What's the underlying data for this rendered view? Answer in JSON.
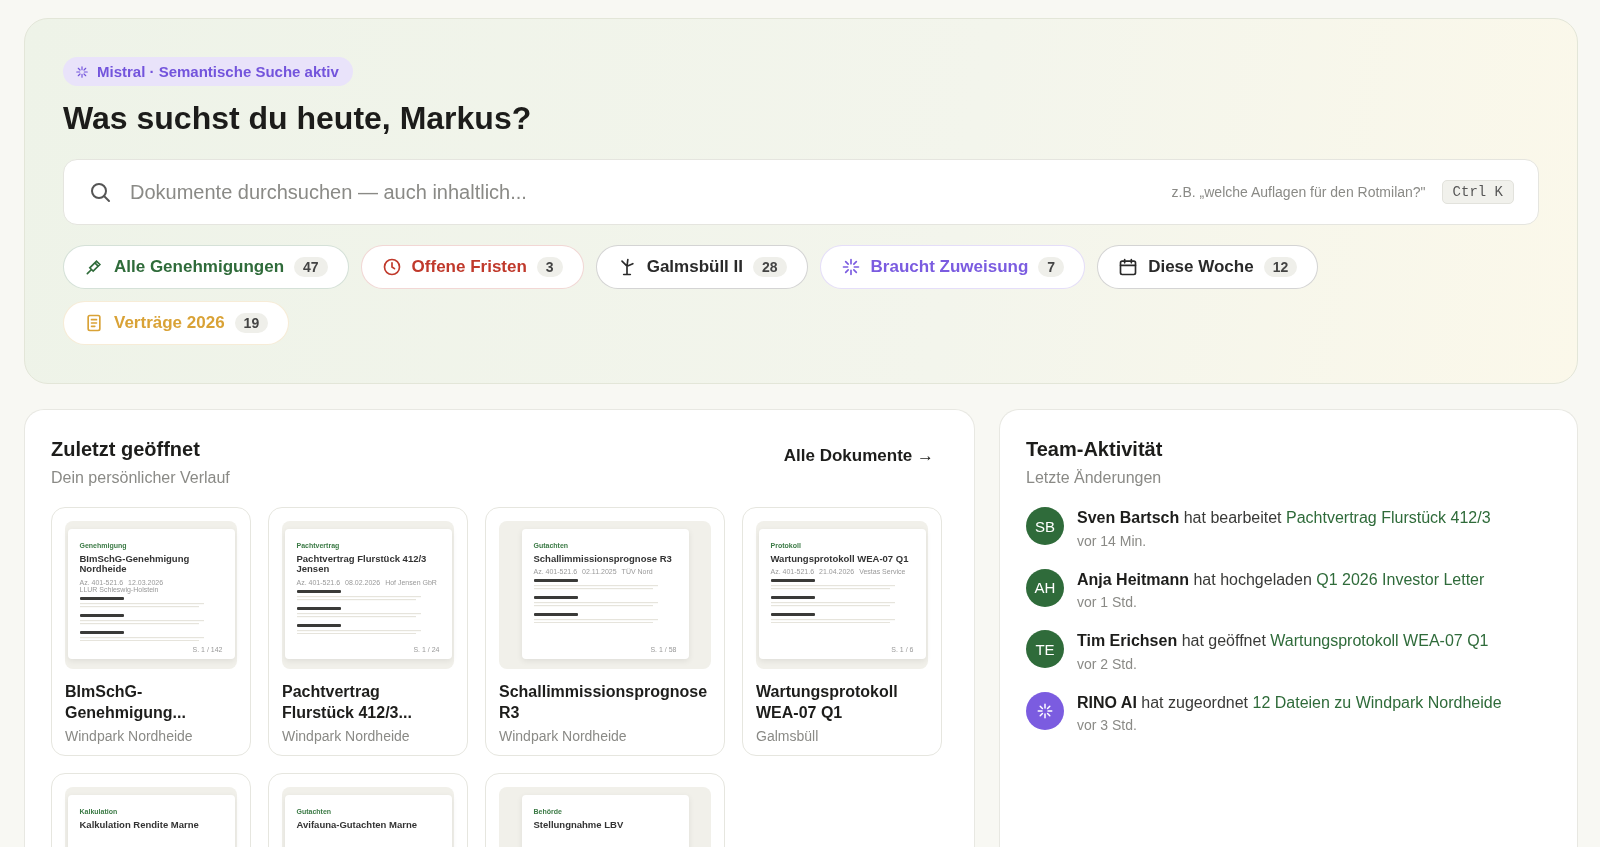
{
  "hero": {
    "badge": "Mistral · Semantische Suche aktiv",
    "heading": "Was suchst du heute, Markus?",
    "search": {
      "placeholder": "Dokumente durchsuchen — auch inhaltlich...",
      "hint": "z.B. „welche Auflagen für den Rotmilan?\"",
      "shortcut": "Ctrl K"
    },
    "chips": [
      {
        "kind": "permit",
        "label": "Alle Genehmigungen",
        "count": "47",
        "color": "#2f6b3a"
      },
      {
        "kind": "deadline",
        "label": "Offene Fristen",
        "count": "3",
        "color": "#c0392b"
      },
      {
        "kind": "site",
        "label": "Galmsbüll II",
        "count": "28",
        "color": "#2a2a2a"
      },
      {
        "kind": "ai",
        "label": "Braucht Zuweisung",
        "count": "7",
        "color": "#7b5ce0"
      },
      {
        "kind": "week",
        "label": "Diese Woche",
        "count": "12",
        "color": "#2a2a2a"
      },
      {
        "kind": "contracts",
        "label": "Verträge 2026",
        "count": "19",
        "color": "#d9a236"
      }
    ]
  },
  "recent": {
    "title": "Zuletzt geöffnet",
    "subtitle": "Dein persönlicher Verlauf",
    "link": "Alle Dokumente →",
    "documents": [
      {
        "category": "Genehmigung",
        "preview_title": "BImSchG-Genehmigung Nordheide",
        "meta": [
          "Az. 401-521.6",
          "12.03.2026",
          "LLUR Schleswig-Holstein"
        ],
        "pages": "S. 1 / 142",
        "title": "BImSchG-Genehmigung...",
        "project": "Windpark Nordheide"
      },
      {
        "category": "Pachtvertrag",
        "preview_title": "Pachtvertrag Flurstück 412/3 Jensen",
        "meta": [
          "Az. 401-521.6",
          "08.02.2026",
          "Hof Jensen GbR"
        ],
        "pages": "S. 1 / 24",
        "title": "Pachtvertrag Flurstück 412/3...",
        "project": "Windpark Nordheide"
      },
      {
        "category": "Gutachten",
        "preview_title": "Schallimmissionsprognose R3",
        "meta": [
          "Az. 401-521.6",
          "02.11.2025",
          "TÜV Nord"
        ],
        "pages": "S. 1 / 58",
        "title": "Schallimmissionsprognose R3",
        "project": "Windpark Nordheide"
      },
      {
        "category": "Protokoll",
        "preview_title": "Wartungsprotokoll WEA-07 Q1",
        "meta": [
          "Az. 401-521.6",
          "21.04.2026",
          "Vestas Service"
        ],
        "pages": "S. 1 / 6",
        "title": "Wartungsprotokoll WEA-07 Q1",
        "project": "Galmsbüll"
      },
      {
        "category": "Kalkulation",
        "preview_title": "Kalkulation Rendite Marne"
      },
      {
        "category": "Gutachten",
        "preview_title": "Avifauna-Gutachten Marne"
      },
      {
        "category": "Behörde",
        "preview_title": "Stellungnahme LBV"
      }
    ]
  },
  "activity": {
    "title": "Team-Aktivität",
    "subtitle": "Letzte Änderungen",
    "items": [
      {
        "kind": "person",
        "initials": "SB",
        "actor": "Sven Bartsch",
        "action": "hat bearbeitet",
        "target": "Pachtvertrag Flurstück 412/3",
        "time": "vor 14 Min."
      },
      {
        "kind": "person",
        "initials": "AH",
        "actor": "Anja Heitmann",
        "action": "hat hochgeladen",
        "target": "Q1 2026 Investor Letter",
        "time": "vor 1 Std."
      },
      {
        "kind": "person",
        "initials": "TE",
        "actor": "Tim Erichsen",
        "action": "hat geöffnet",
        "target": "Wartungsprotokoll WEA-07 Q1",
        "time": "vor 2 Std."
      },
      {
        "kind": "ai",
        "actor": "RINO AI",
        "action": "hat zugeordnet",
        "target": "12 Dateien zu Windpark Nordheide",
        "time": "vor 3 Std."
      }
    ]
  }
}
